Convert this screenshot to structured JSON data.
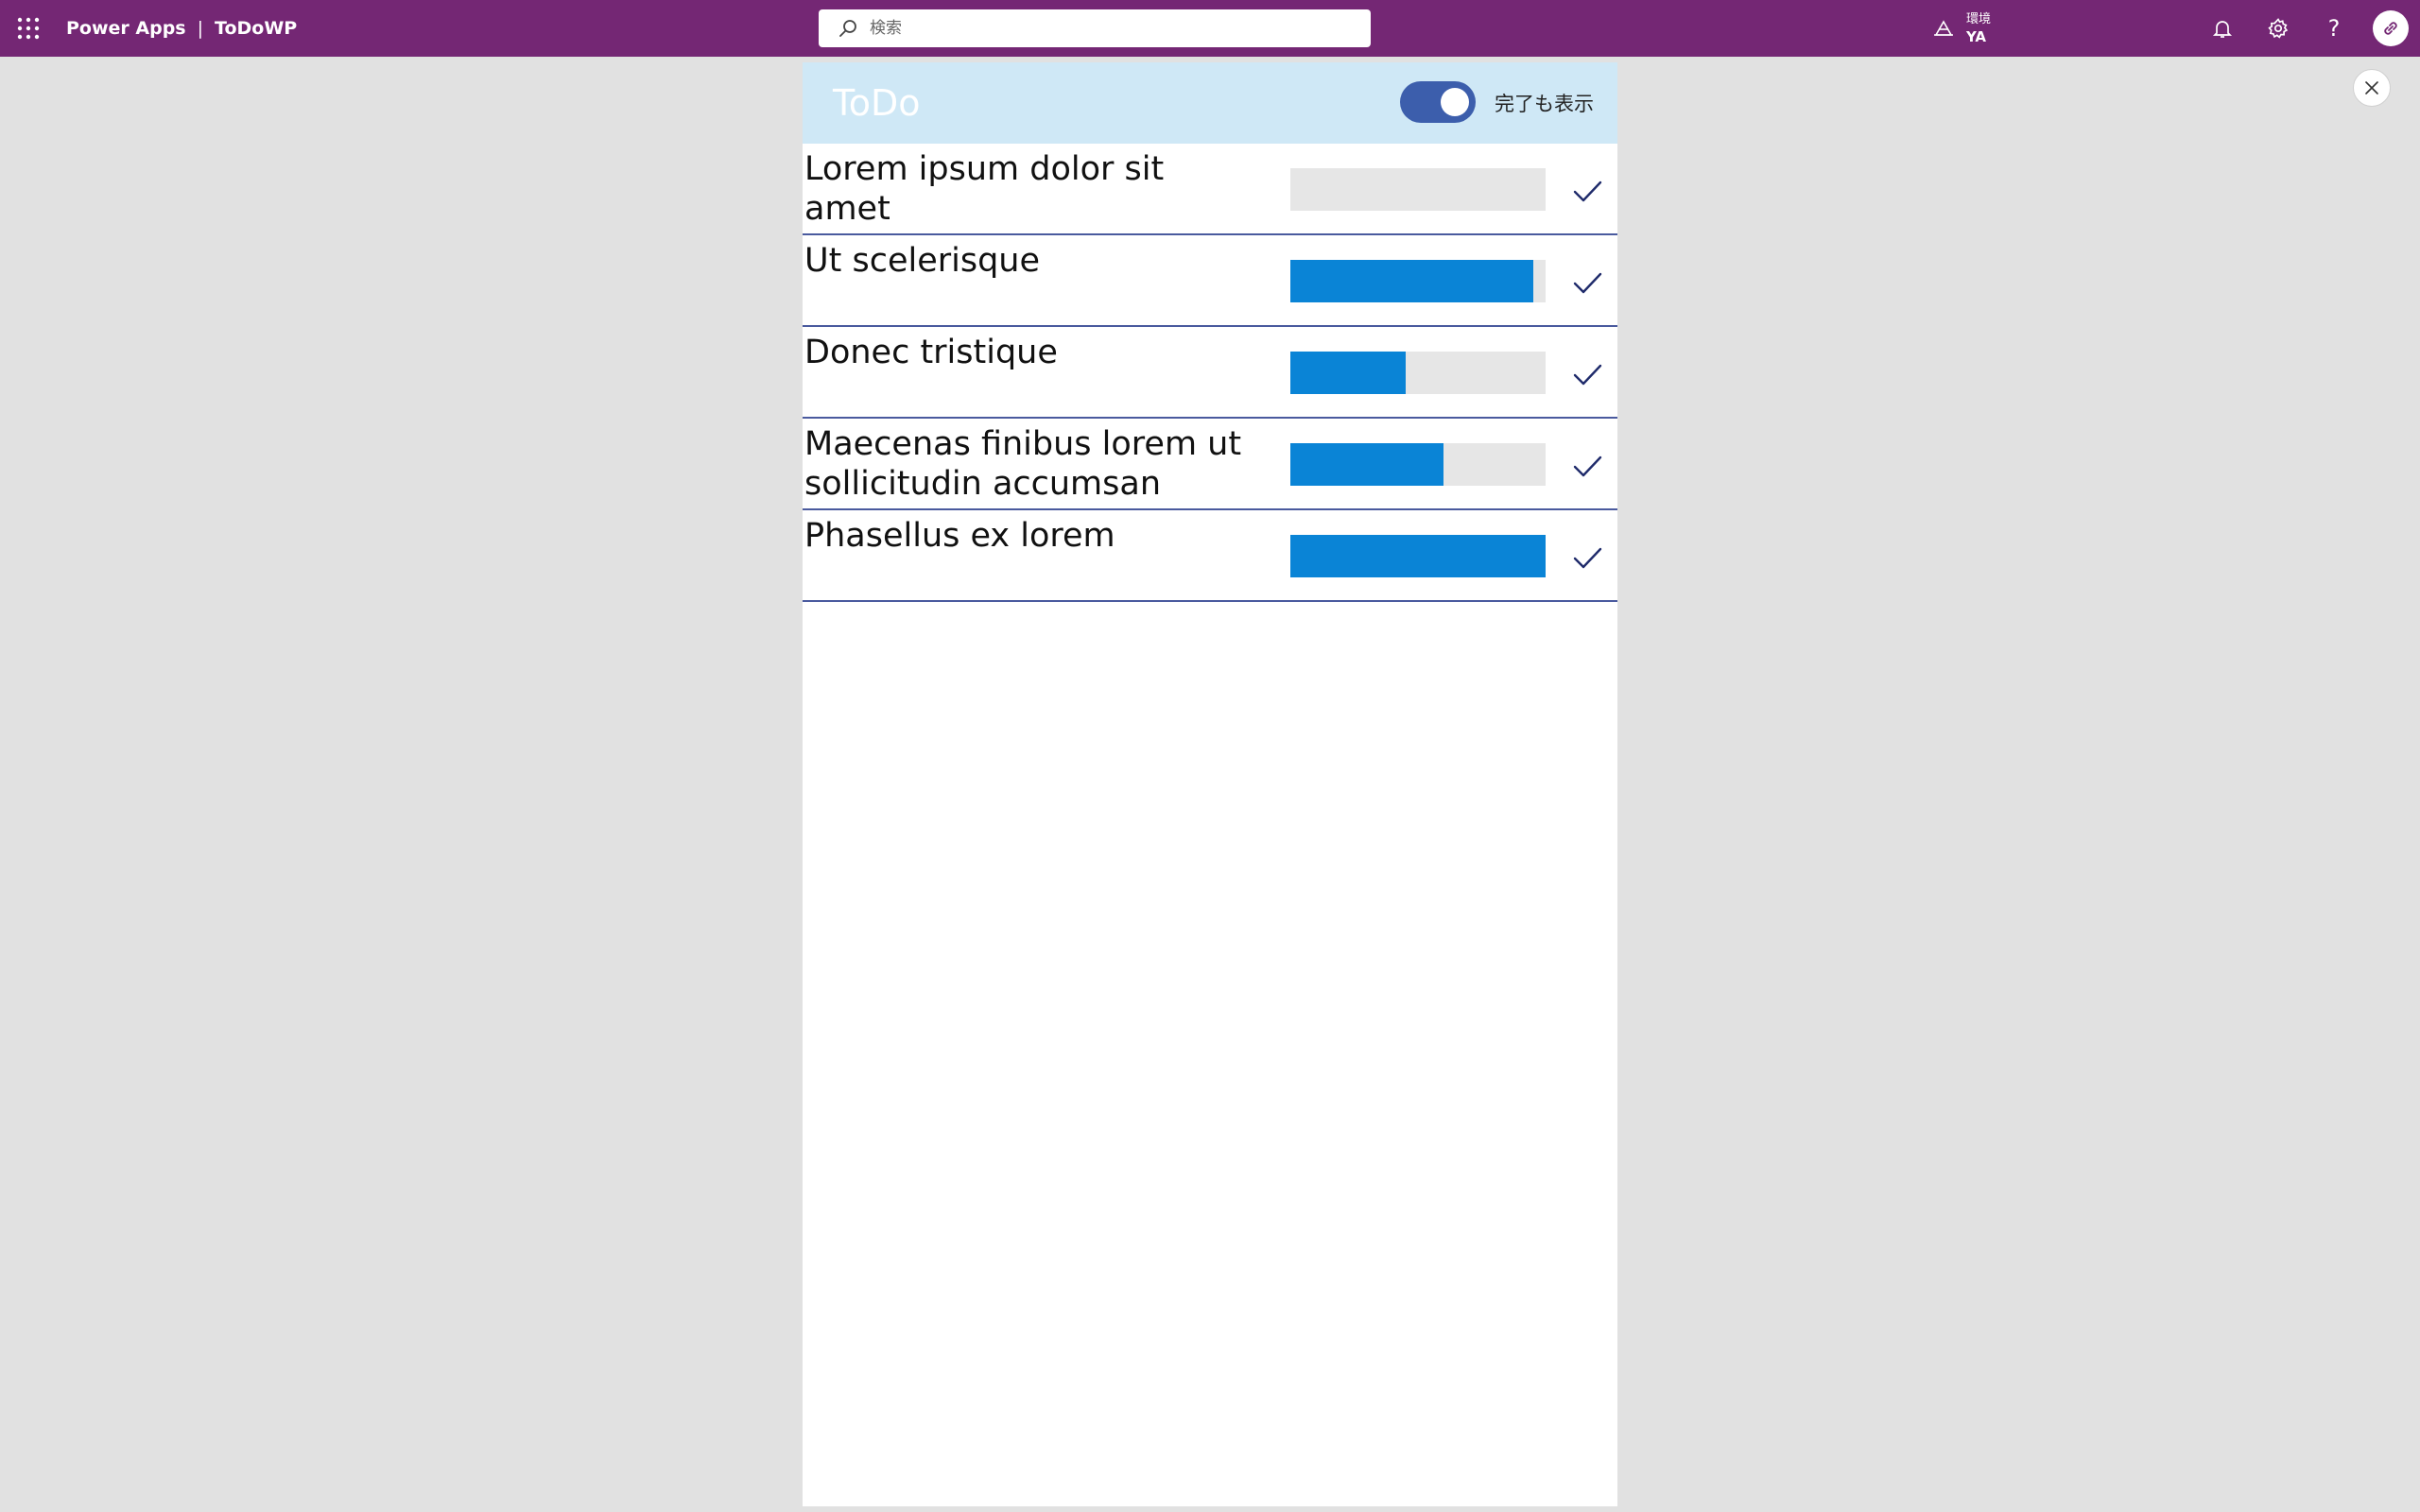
{
  "header": {
    "app_name": "Power Apps",
    "separator": "|",
    "doc_name": "ToDoWP",
    "search_placeholder": "検索",
    "environment_label": "環境",
    "environment_value": "YA",
    "icons": [
      "waffle-icon",
      "search-icon",
      "environment-icon",
      "bell-icon",
      "gear-icon",
      "help-icon",
      "avatar"
    ],
    "help_glyph": "?",
    "brand_color": "#742774"
  },
  "app": {
    "title": "ToDo",
    "toggle_label": "完了も表示",
    "toggle_on": true,
    "header_color": "#cfe8f6",
    "bar_color": "#0a84d6",
    "items": [
      {
        "title": "Lorem ipsum dolor sit amet",
        "progress": 0.0
      },
      {
        "title": "Ut scelerisque",
        "progress": 0.95
      },
      {
        "title": "Donec tristique",
        "progress": 0.45
      },
      {
        "title": "Maecenas finibus lorem ut sollicitudin accumsan",
        "progress": 0.6
      },
      {
        "title": "Phasellus ex lorem",
        "progress": 1.0
      }
    ]
  }
}
